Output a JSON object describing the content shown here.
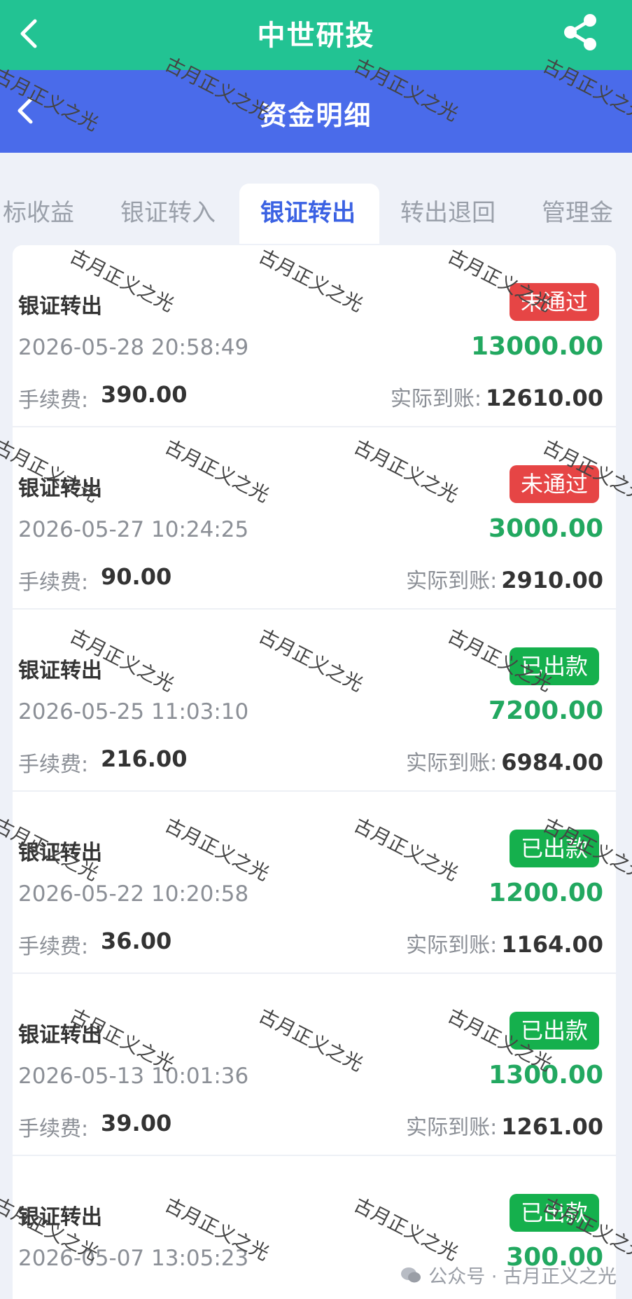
{
  "app": {
    "title": "中世研投"
  },
  "page": {
    "title": "资金明细"
  },
  "tabs": [
    {
      "label": "标收益",
      "active": false
    },
    {
      "label": "银证转入",
      "active": false
    },
    {
      "label": "银证转出",
      "active": true
    },
    {
      "label": "转出退回",
      "active": false
    },
    {
      "label": "管理金",
      "active": false
    }
  ],
  "labels": {
    "fee": "手续费:",
    "actual": "实际到账:"
  },
  "records": [
    {
      "title": "银证转出",
      "status": "未通过",
      "status_type": "fail",
      "time": "2026-05-28 20:58:49",
      "amount": "13000.00",
      "fee": "390.00",
      "actual": "12610.00"
    },
    {
      "title": "银证转出",
      "status": "未通过",
      "status_type": "fail",
      "time": "2026-05-27 10:24:25",
      "amount": "3000.00",
      "fee": "90.00",
      "actual": "2910.00"
    },
    {
      "title": "银证转出",
      "status": "已出款",
      "status_type": "paid",
      "time": "2026-05-25 11:03:10",
      "amount": "7200.00",
      "fee": "216.00",
      "actual": "6984.00"
    },
    {
      "title": "银证转出",
      "status": "已出款",
      "status_type": "paid",
      "time": "2026-05-22 10:20:58",
      "amount": "1200.00",
      "fee": "36.00",
      "actual": "1164.00"
    },
    {
      "title": "银证转出",
      "status": "已出款",
      "status_type": "paid",
      "time": "2026-05-13 10:01:36",
      "amount": "1300.00",
      "fee": "39.00",
      "actual": "1261.00"
    },
    {
      "title": "银证转出",
      "status": "已出款",
      "status_type": "paid",
      "time": "2026-05-07 13:05:23",
      "amount": "300.00",
      "fee": "",
      "actual": ""
    }
  ],
  "watermark": {
    "text": "古月正义之光",
    "footer": "公众号 · 古月正义之光"
  },
  "colors": {
    "topbar": "#22c393",
    "subbar": "#4a6bea",
    "active_tab": "#3b62e3",
    "amount": "#22a860",
    "status_fail": "#e64545",
    "status_paid": "#15b04d"
  },
  "icons": {
    "back": "chevron-left-icon",
    "share": "share-icon"
  }
}
